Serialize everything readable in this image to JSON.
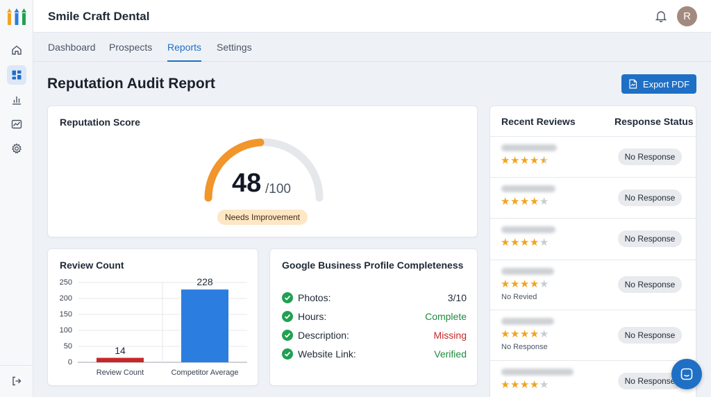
{
  "app": {
    "brand": "Smile Craft Dental",
    "avatar_initial": "R"
  },
  "tabs": [
    {
      "label": "Dashboard"
    },
    {
      "label": "Prospects"
    },
    {
      "label": "Reports",
      "active": true
    },
    {
      "label": "Settings"
    }
  ],
  "page": {
    "title": "Reputation Audit Report",
    "export_label": "Export PDF"
  },
  "score_card": {
    "title": "Reputation Score",
    "score": "48",
    "max": "/100",
    "score_value": 48,
    "status": "Needs Improvement",
    "colors": {
      "progress": "#f2952a",
      "track": "#e5e7eb"
    }
  },
  "review_count_card": {
    "title": "Review Count"
  },
  "chart_data": {
    "type": "bar",
    "title": "Review Count",
    "categories": [
      "Review Count",
      "Competitor Average"
    ],
    "values": [
      14,
      228
    ],
    "colors": [
      "#c62828",
      "#2b7de0"
    ],
    "ylim": [
      0,
      250
    ],
    "yticks": [
      "250",
      "200",
      "150",
      "100",
      "50",
      "0"
    ],
    "grid": true
  },
  "gbp_card": {
    "title": "Google Business Profile Completeness",
    "rows": [
      {
        "label": "Photos:",
        "value": "3/10",
        "color": "#1f2937"
      },
      {
        "label": "Hours:",
        "value": "Complete",
        "color": "#1f8a3e"
      },
      {
        "label": "Description:",
        "value": "Missing",
        "color": "#c62828"
      },
      {
        "label": "Website Link:",
        "value": "Verified",
        "color": "#1f8a3e"
      }
    ]
  },
  "reviews_card": {
    "title": "Recent Reviews",
    "status_header": "Response Status",
    "reviews": [
      {
        "rating": 4.5,
        "sub": "",
        "status": "No Response"
      },
      {
        "rating": 4,
        "sub": "",
        "status": "No Response"
      },
      {
        "rating": 4,
        "sub": "",
        "status": "No Response"
      },
      {
        "rating": 4,
        "sub": "No Revied",
        "status": "No Response"
      },
      {
        "rating": 4,
        "sub": "No Response",
        "status": "No Response"
      },
      {
        "rating": 4,
        "sub": "",
        "status": "No Response"
      }
    ]
  }
}
